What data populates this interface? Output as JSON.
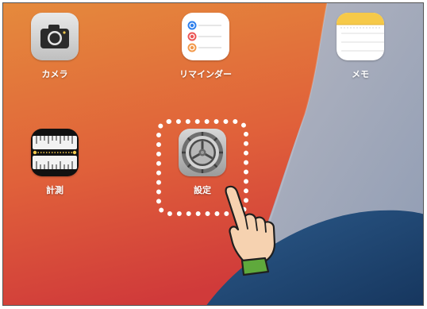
{
  "apps": [
    {
      "label": "カメラ",
      "icon": "camera-icon"
    },
    {
      "label": "リマインダー",
      "icon": "reminders-icon"
    },
    {
      "label": "メモ",
      "icon": "notes-icon"
    },
    {
      "label": "計測",
      "icon": "measure-icon"
    },
    {
      "label": "設定",
      "icon": "settings-icon"
    }
  ],
  "colors": {
    "wallpaper_orange": "#e8773a",
    "wallpaper_red": "#d9473b",
    "wallpaper_gray": "#a6afc2",
    "wallpaper_blue": "#234e7d",
    "notes_yellow": "#f6c948",
    "highlight": "#ffffff",
    "hand_skin": "#f6d2b0",
    "sleeve_green": "#5fa93c"
  }
}
